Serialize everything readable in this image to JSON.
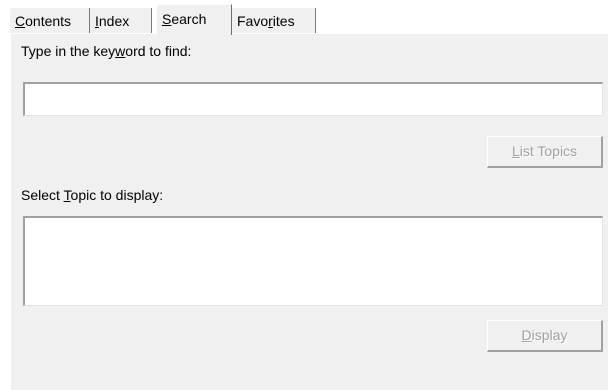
{
  "tabs": [
    {
      "label_pre": "",
      "label_key": "C",
      "label_post": "ontents"
    },
    {
      "label_pre": "",
      "label_key": "I",
      "label_post": "ndex"
    },
    {
      "label_pre": "",
      "label_key": "S",
      "label_post": "earch"
    },
    {
      "label_pre": "Favo",
      "label_key": "r",
      "label_post": "ites"
    }
  ],
  "selected_tab": "Search",
  "search": {
    "keyword_label_pre": "Type in the key",
    "keyword_label_key": "w",
    "keyword_label_post": "ord to find:",
    "keyword_value": "",
    "list_topics_pre": "",
    "list_topics_key": "L",
    "list_topics_post": "ist Topics",
    "select_label_pre": "Select ",
    "select_label_key": "T",
    "select_label_post": "opic to display:",
    "display_pre": "",
    "display_key": "D",
    "display_post": "isplay"
  }
}
